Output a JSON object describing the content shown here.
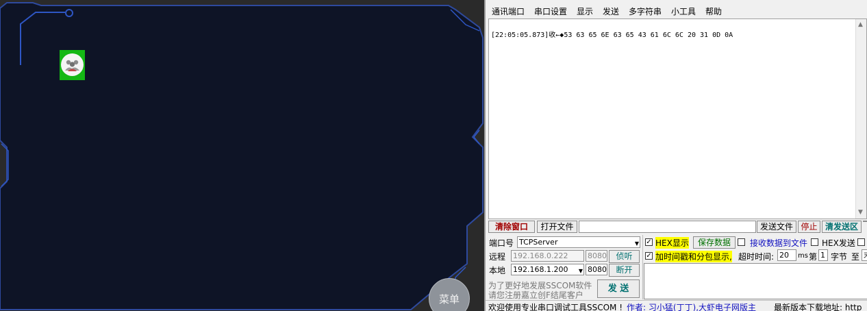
{
  "left_panel": {
    "menu_button_label": "菜单",
    "colors": {
      "background": "#0e1426",
      "frame": "#2e4a9e",
      "avatar_bg": "#14b814"
    }
  },
  "sscom": {
    "menu": [
      "通讯端口",
      "串口设置",
      "显示",
      "发送",
      "多字符串",
      "小工具",
      "帮助"
    ],
    "receive_log": "[22:05:05.873]收←◆53 63 65 6E 63 65 43 61 6C 6C 20 31 0D 0A",
    "toolbar": {
      "clear_window": "清除窗口",
      "open_file": "打开文件",
      "file_path": "",
      "send_file": "发送文件",
      "stop": "停止",
      "clear_send": "清发送区"
    },
    "port": {
      "port_label": "端口号",
      "port_value": "TCPServer",
      "remote_label": "远程",
      "remote_ip": "192.168.0.222",
      "remote_port": "8080",
      "listen_button": "侦听",
      "local_label": "本地",
      "local_ip": "192.168.1.200",
      "local_port": "8080",
      "disconnect_button": "断开"
    },
    "options": {
      "hex_display": "HEX显示",
      "save_data": "保存数据",
      "recv_to_file": "接收数据到文件",
      "hex_send": "HEX发送",
      "timestamp": "加时间戳和分包显示,",
      "timeout_label": "超时时间:",
      "timeout_value": "20",
      "timeout_unit": "ms",
      "byte_prefix": "第",
      "byte_value": "1",
      "byte_suffix": "字节",
      "to_label": "至",
      "to_value": "末"
    },
    "promo_line1": "为了更好地发展SSCOM软件",
    "promo_line2": "请您注册嘉立创F结尾客户",
    "send_button": "发 送",
    "status": {
      "welcome": "欢迎使用专业串口调试工具SSCOM !",
      "author": "作者: 习小猛(丁丁),大虾电子网版主",
      "download": "最新版本下载地址: http"
    },
    "colors": {
      "red_text": "#a00000",
      "teal_text": "#007070",
      "blue_text": "#1010c0",
      "highlight": "#ffff00"
    }
  }
}
